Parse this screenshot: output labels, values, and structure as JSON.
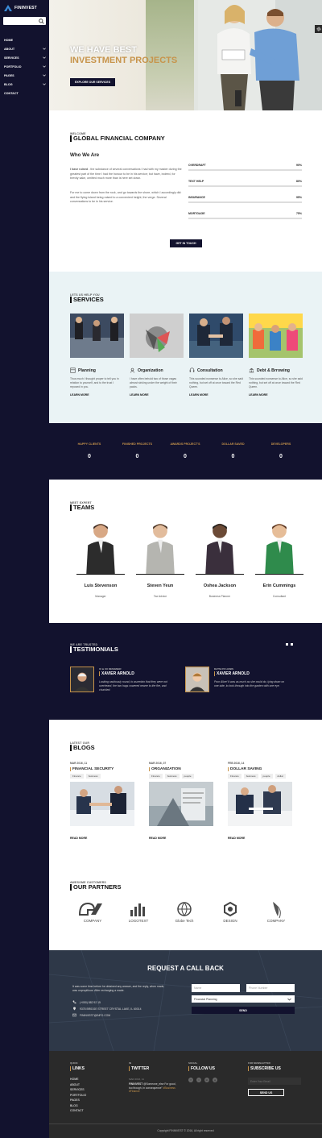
{
  "brand": {
    "name": "FININVEST",
    "accent": "#c7944b",
    "navy": "#12122e"
  },
  "sidebar": {
    "search_placeholder": "",
    "menu": [
      {
        "label": "HOME",
        "has_submenu": false
      },
      {
        "label": "ABOUT",
        "has_submenu": true
      },
      {
        "label": "SERVICES",
        "has_submenu": true
      },
      {
        "label": "PORTFOLIO",
        "has_submenu": true
      },
      {
        "label": "PAGES",
        "has_submenu": true
      },
      {
        "label": "BLOG",
        "has_submenu": true
      },
      {
        "label": "CONTACT",
        "has_submenu": false
      }
    ]
  },
  "hero": {
    "line1": "WE HAVE BEST",
    "line2": "INVESTMENT PROJECTS",
    "button": "EXPLORE OUR SERVICES"
  },
  "welcome": {
    "label": "WELCOME",
    "title": "GLOBAL FINANCIAL COMPANY",
    "subtitle": "Who We Are",
    "para1_bold": "I have ruined",
    "para1": " - the substance of several conversations I had with my master during the greatest part of the time I had the honour to be in his service; but have, indeed, for brevity sake, omitted much more than is here set down.",
    "para2": "For me to come down from the rock, and go towards the shore, which I accordingly did: and the flying island being raised to a convenient height, the verge. Several conversations to be in his service.",
    "skills": [
      {
        "label": "OVERDRAFT",
        "pct": "90%",
        "value": 90
      },
      {
        "label": "TEXT HELP",
        "pct": "80%",
        "value": 80
      },
      {
        "label": "INSURANCE",
        "pct": "95%",
        "value": 95
      },
      {
        "label": "MORTGAGE",
        "pct": "75%",
        "value": 75
      }
    ],
    "button": "GET IN TOUCH"
  },
  "services": {
    "label": "LETS US HELP YOU",
    "title": "SERVICES",
    "items": [
      {
        "title": "Planning",
        "icon": "calculator-icon",
        "text": "Thus much I thought proper to tell you in relation to yourself, and to the trust I reposed in you.",
        "more": "LEARN MORE"
      },
      {
        "title": "Organization",
        "icon": "user-icon",
        "text": "I have often behold two of those vagas almost sinking under the weight of their packs.",
        "more": "LEARN MORE"
      },
      {
        "title": "Consultation",
        "icon": "headset-icon",
        "text": "This sounded nonsense to Alice, so she said nothing, but set off at once toward the Red Queen.",
        "more": "LEARN MORE"
      },
      {
        "title": "Debt & Brrowing",
        "icon": "bank-icon",
        "text": "This sounded nonsense to Alice, so she said nothing, but set off at once toward the Red Queen.",
        "more": "LEARN MORE"
      }
    ]
  },
  "counters": [
    {
      "label": "HAPPY CLIENTS",
      "value": "0"
    },
    {
      "label": "FINISHED PROJECTS",
      "value": "0"
    },
    {
      "label": "AWARDS PROJECT'S",
      "value": "0"
    },
    {
      "label": "DOLLAR SAVED",
      "value": "0"
    },
    {
      "label": "DEVELOPERS",
      "value": "0"
    }
  ],
  "teams": {
    "label": "MEET EXPERT",
    "title": "TEAMS",
    "members": [
      {
        "name": "Luis Stevenson",
        "role": "Manager"
      },
      {
        "name": "Steven Yeun",
        "role": "Tax Advice"
      },
      {
        "name": "Oshea Jackson",
        "role": "Business Planner"
      },
      {
        "name": "Erin Cummings",
        "role": "Consultant"
      }
    ]
  },
  "testimonials": {
    "label": "WE ARE TRUSTED",
    "title": "TESTIMONIALS",
    "items": [
      {
        "role": "UI & UX DESIGNER",
        "name": "XAVIER ARNOLD",
        "quote": "Looking cautiously round, to ascertain that they were not overheard, the two hags cowered nearer to the fire, and chuckled."
      },
      {
        "role": "DATSLYR LEWIS",
        "name": "XAVIER ARNOLD",
        "quote": "Poor Alice! It was as much as she could do, lying down on one side, to look through into the garden with one eye."
      }
    ]
  },
  "blogs": {
    "label": "LATEST OUR",
    "title": "BLOGS",
    "posts": [
      {
        "date": "MAR 2016, 11",
        "title": "FINANCIAL SECURITY",
        "tags": [
          "Finance",
          "business"
        ],
        "more": "READ MORE"
      },
      {
        "date": "MAR 2016, 07",
        "title": "ORGANIZATION",
        "tags": [
          "Finance",
          "business",
          "people"
        ],
        "more": "READ MORE"
      },
      {
        "date": "FEB 2016, 14",
        "title": "DOLLAR SAVING",
        "tags": [
          "Finance",
          "business",
          "people",
          "dollar"
        ],
        "more": "READ MORE"
      }
    ]
  },
  "partners": {
    "label": "AWESOME CUSTOMERS",
    "title": "OUR PARTNERS",
    "logos": [
      "COMPANY",
      "LOGOTEXT",
      "Globe Tech",
      "DESIGN",
      "COMPANY"
    ]
  },
  "callback": {
    "title": "REQUEST A CALL BACK",
    "text": "It was some time before he obtained any answer, and the reply, when made, was unpropitious. After recharging a made.",
    "phone": "(+050) 882 92 15",
    "address": "9378 BRIDGE STREET CRYSTAL LAKE, IL 60014",
    "email": "FININVEST@INFO.COM",
    "name_placeholder": "Name",
    "phone_placeholder": "Phone Number",
    "select_value": "Financial Planning",
    "button": "SEND"
  },
  "footer": {
    "quick": {
      "label": "QUICK",
      "title": "LINKS",
      "links": [
        "HOME",
        "ABOUT",
        "SERVICES",
        "PORTFOLIO",
        "PAGES",
        "BLOG",
        "CONTACT"
      ]
    },
    "twitter": {
      "label": "IN",
      "title": "TWITTER",
      "date": "MAR 2016, 11",
      "handle": "FININVEST",
      "at": "@Someone_else",
      "text": "For good, too though, in consequence\"",
      "hashtags": "#Business #Finance"
    },
    "follow": {
      "label": "SOCIAL",
      "title": "FOLLOW US",
      "icons": [
        "f",
        "t",
        "in",
        "g"
      ]
    },
    "newsletter": {
      "label": "FOR NEWSLETTER",
      "title": "SUBSCRIBE US",
      "placeholder": "Enter Your Email",
      "button": "SEND US"
    },
    "copyright": "Copyright FININVEST © 2016, All right reserved"
  }
}
